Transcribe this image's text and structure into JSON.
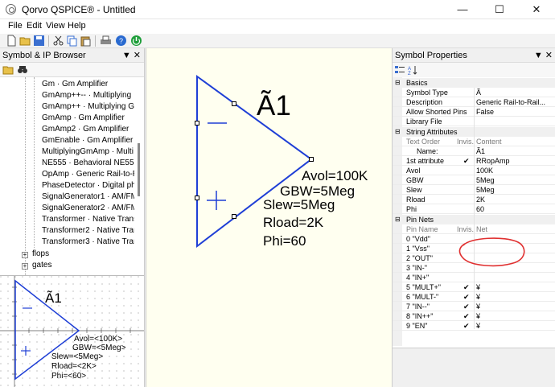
{
  "window": {
    "title": "Qorvo QSPICE® - Untitled",
    "minimize": "—",
    "maximize": "☐",
    "close": "✕"
  },
  "menu": [
    "File",
    "Edit",
    "View",
    "Help"
  ],
  "toolbar_icons": [
    "new-file-icon",
    "open-folder-icon",
    "save-icon",
    "cut-icon",
    "copy-icon",
    "paste-icon",
    "print-icon",
    "help-icon",
    "run-icon"
  ],
  "browser": {
    "title": "Symbol & IP Browser",
    "items": [
      "Gm · Gm Amplifier",
      "GmAmp++-- · Multiplying",
      "GmAmp++ · Multiplying Gi",
      "GmAmp · Gm Amplifier",
      "GmAmp2 · Gm Amplifier",
      "GmEnable · Gm Amplifier",
      "MultiplyingGmAmp · Multi",
      "NE555 · Behavioral NE555",
      "OpAmp · Generic Rail-to-R",
      "PhaseDetector · Digital pha",
      "SignalGenerator1 · AM/FM",
      "SignalGenerator2 · AM/FM",
      "Transformer · Native Transf",
      "Transformer2 · Native Trans",
      "Transformer3 · Native Trans"
    ],
    "folders": [
      "flops",
      "gates"
    ]
  },
  "schematic": {
    "ref": "Ã1",
    "minus": "—",
    "plus": "+",
    "attrs": [
      "Avol=100K",
      "GBW=5Meg",
      "Slew=5Meg",
      "Rload=2K",
      "Phi=60"
    ]
  },
  "preview": {
    "ref": "Ã1",
    "attrs": [
      "Avol=<100K>",
      "GBW=<5Meg>",
      "Slew=<5Meg>",
      "Rload=<2K>",
      "Phi=<60>"
    ]
  },
  "props": {
    "title": "Symbol Properties",
    "basics_header": "Basics",
    "basics": [
      {
        "k": "Symbol Type",
        "v": "Ã"
      },
      {
        "k": "Description",
        "v": "Generic Rail-to-Rail..."
      },
      {
        "k": "Allow Shorted Pins",
        "v": "False"
      },
      {
        "k": "Library File",
        "v": ""
      }
    ],
    "string_header": "String Attributes",
    "string_cols": [
      "Text Order",
      "Invis.",
      "Content"
    ],
    "string_rows": [
      {
        "k": "Name:",
        "inv": "",
        "v": "Ã1"
      },
      {
        "k": "1st attribute",
        "inv": "✔",
        "v": "RRopAmp"
      },
      {
        "k": "Avol",
        "inv": "",
        "v": "100K"
      },
      {
        "k": "GBW",
        "inv": "",
        "v": "5Meg"
      },
      {
        "k": "Slew",
        "inv": "",
        "v": "5Meg"
      },
      {
        "k": "Rload",
        "inv": "",
        "v": "2K"
      },
      {
        "k": "Phi",
        "inv": "",
        "v": "60"
      }
    ],
    "pin_header": "Pin Nets",
    "pin_cols": [
      "Pin Name",
      "Invis.",
      "Net"
    ],
    "pin_rows": [
      {
        "k": "0 \"Vdd\"",
        "inv": "",
        "v": ""
      },
      {
        "k": "1 \"Vss\"",
        "inv": "",
        "v": ""
      },
      {
        "k": "2 \"OUT\"",
        "inv": "",
        "v": ""
      },
      {
        "k": "3 \"IN-\"",
        "inv": "",
        "v": ""
      },
      {
        "k": "4 \"IN+\"",
        "inv": "",
        "v": ""
      },
      {
        "k": "5 \"MULT+\"",
        "inv": "✔",
        "v": "¥"
      },
      {
        "k": "6 \"MULT-\"",
        "inv": "✔",
        "v": "¥"
      },
      {
        "k": "7 \"IN--\"",
        "inv": "✔",
        "v": "¥"
      },
      {
        "k": "8 \"IN++\"",
        "inv": "✔",
        "v": "¥"
      },
      {
        "k": "9 \"EN\"",
        "inv": "✔",
        "v": "¥"
      }
    ]
  },
  "colors": {
    "symbol": "#1f3fd6",
    "annotation": "#e03030",
    "canvas": "#fffff0"
  }
}
